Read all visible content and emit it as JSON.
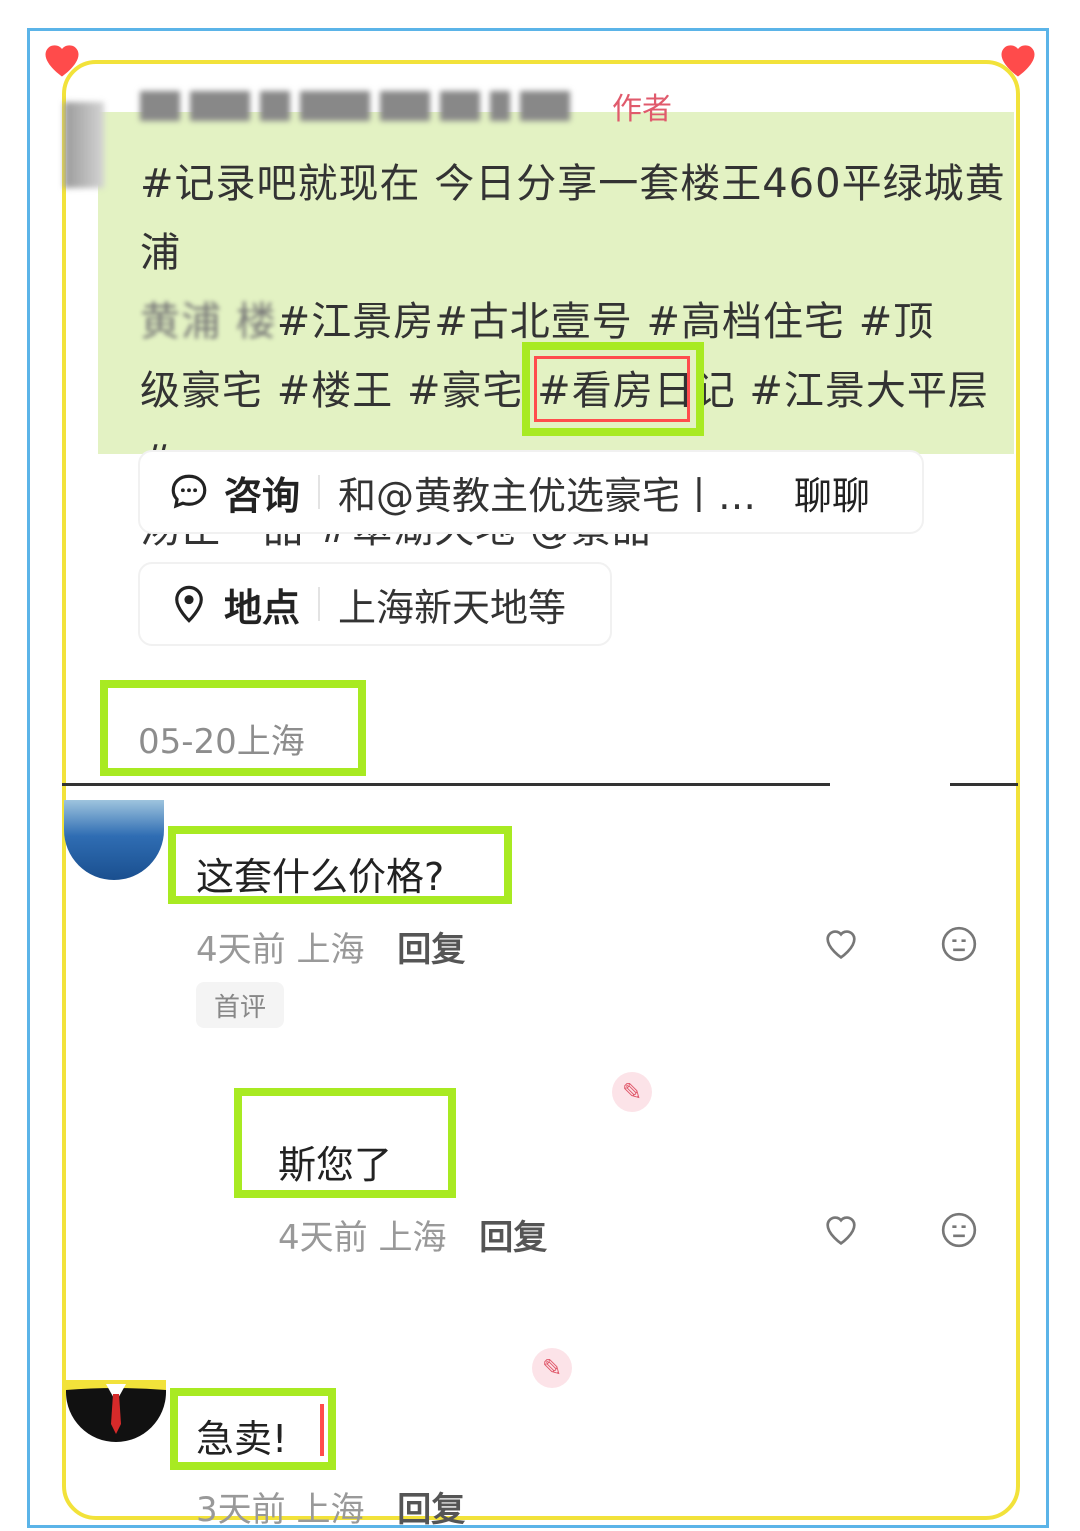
{
  "post": {
    "author_tag": "作者",
    "text": "#记录吧就现在 今日分享一套楼王460平绿城黄浦",
    "text_line2": "#江景房#古北壹号 #高档住宅 #顶",
    "text_line3": "级豪宅 #楼王 #豪宅 #看房日记 #江景大平层 #",
    "text_line4": "汤臣一品 #翠湖天地 ",
    "mention": "@景甜"
  },
  "consult": {
    "title": "咨询",
    "value": "和@黄教主优选豪宅丨…",
    "action": "聊聊"
  },
  "location": {
    "title": "地点",
    "value": "上海新天地等"
  },
  "date": "05-20上海",
  "comments": [
    {
      "text": "这套什么价格?",
      "time": "4天前",
      "place": "上海",
      "reply": "回复",
      "badge": "首评"
    },
    {
      "text": "斯您了",
      "time": "4天前",
      "place": "上海",
      "reply": "回复"
    },
    {
      "text": "急卖!",
      "time": "3天前",
      "place": "上海",
      "reply": "回复"
    }
  ],
  "colors": {
    "highlight_green": "#a8ea22",
    "highlight_red": "#ff4d4d",
    "post_bg": "#e3f2c3",
    "frame_blue": "#5bb4e8",
    "frame_yellow": "#f2e23a"
  }
}
